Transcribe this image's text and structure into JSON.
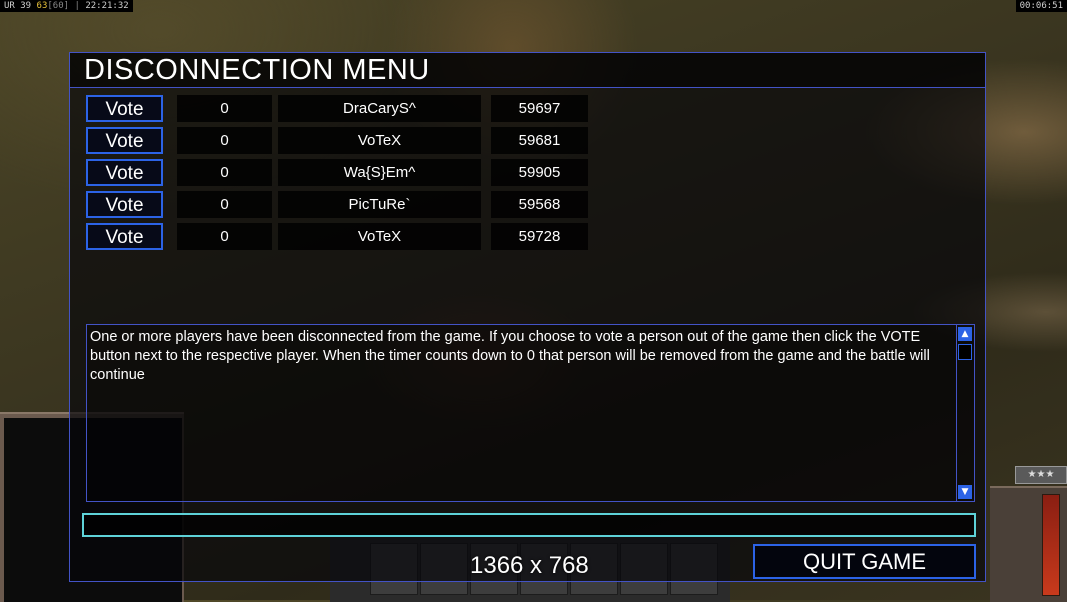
{
  "hud": {
    "left_prefix": "UR",
    "left_a": "39",
    "left_b": "63",
    "left_c": "[60]",
    "left_time": "22:21:32",
    "right_time": "00:06:51"
  },
  "dialog": {
    "title": "DISCONNECTION MENU",
    "vote_label": "Vote",
    "players": [
      {
        "votes": "0",
        "name": "DraCaryS^",
        "timer": "59697"
      },
      {
        "votes": "0",
        "name": "VoTeX",
        "timer": "59681"
      },
      {
        "votes": "0",
        "name": "Wa{S}Em^",
        "timer": "59905"
      },
      {
        "votes": "0",
        "name": "PicTuRe`",
        "timer": "59568"
      },
      {
        "votes": "0",
        "name": "VoTeX",
        "timer": "59728"
      }
    ],
    "message": "One or more players have been disconnected from the game. If you choose to vote a person out of the game then click the VOTE button next to the respective player. When the timer counts down to 0 that person will be removed from the game and the battle will continue",
    "chat_value": "",
    "quit_label": "QUIT GAME"
  },
  "overlay": {
    "resolution": "1366 x 768"
  },
  "colors": {
    "accent_blue": "#2c63e6",
    "border_blue": "#4353c6",
    "chat_border": "#5ed2d8"
  }
}
